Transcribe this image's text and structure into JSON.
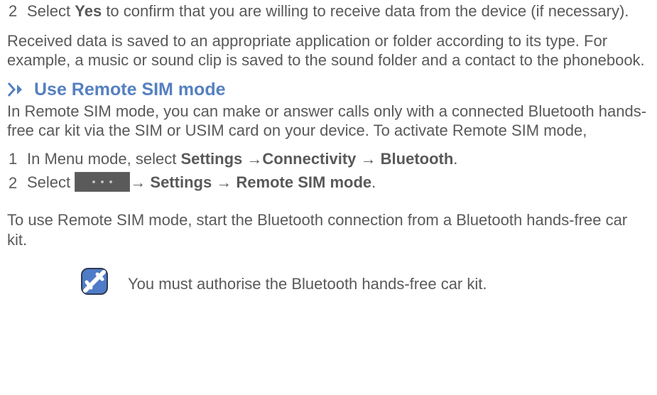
{
  "step2": {
    "num": "2",
    "pre": "Select ",
    "bold": "Yes",
    "post": " to confirm that you are willing to receive data from the device (if necessary)."
  },
  "received_para": "Received data is saved to an appropriate application or folder according to its type. For example, a music or sound clip is saved to the sound folder and a contact to the phonebook.",
  "heading": "Use Remote SIM mode",
  "heading_desc": "In Remote SIM mode, you can make or answer calls only with a connected Bluetooth hands-free car kit via the SIM or USIM card on your device. To activate Remote SIM mode,",
  "stepA": {
    "num": "1",
    "pre": "In Menu mode, select ",
    "b1": "Settings",
    "arrow1": " →",
    "b2": "Connectivity",
    "arrow2": " → ",
    "b3": "Bluetooth",
    "dot": "."
  },
  "stepB": {
    "num": "2",
    "pre": "Select  ",
    "arrow1": "→ ",
    "b1": "Settings",
    "arrow2": " → ",
    "b2": "Remote SIM mode",
    "dot": "."
  },
  "tail_para": "To use Remote SIM mode, start the Bluetooth connection from a Bluetooth hands-free car kit.",
  "note": "You must authorise the Bluetooth hands-free car kit."
}
